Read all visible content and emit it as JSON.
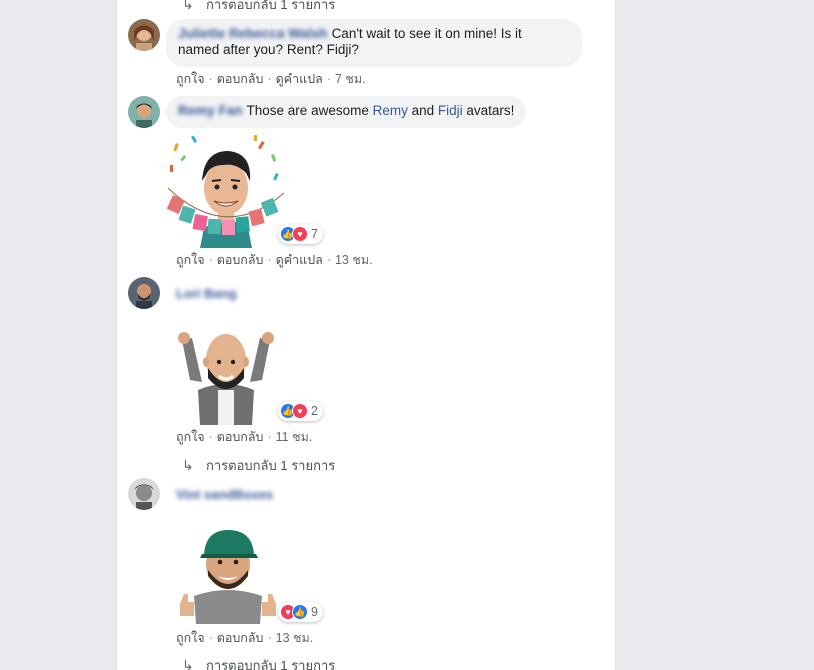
{
  "reply_link_label": "การตอบกลับ 1 รายการ",
  "actions": {
    "like": "ถูกใจ",
    "reply": "ตอบกลับ",
    "translate": "ดูคำแปล",
    "sep": "·"
  },
  "comments": [
    {
      "author": "Juliette Rebecca Walsh",
      "text_part1": "Can't wait to see it on mine! Is it",
      "text_part2": "named after you? Rent? Fidji?",
      "time": "7 ชม."
    },
    {
      "author": "Remy Fan",
      "text_prefix": "Those are awesome ",
      "tag1": "Remy",
      "text_mid": " and ",
      "tag2": "Fidji",
      "text_suffix": " avatars!",
      "reaction_count": "7",
      "time": "13 ชม."
    },
    {
      "author": "Lori Bang",
      "reaction_count": "2",
      "time": "11 ชม."
    },
    {
      "author": "Vint sandBoxes",
      "reaction_count": "9",
      "time": "13 ชม."
    }
  ],
  "colors": {
    "background": "#e9ebee",
    "card": "#ffffff",
    "link_blue": "#385898",
    "like_blue": "#2078f4",
    "love_red": "#f33e58",
    "bubble_gray": "#f2f3f5"
  }
}
